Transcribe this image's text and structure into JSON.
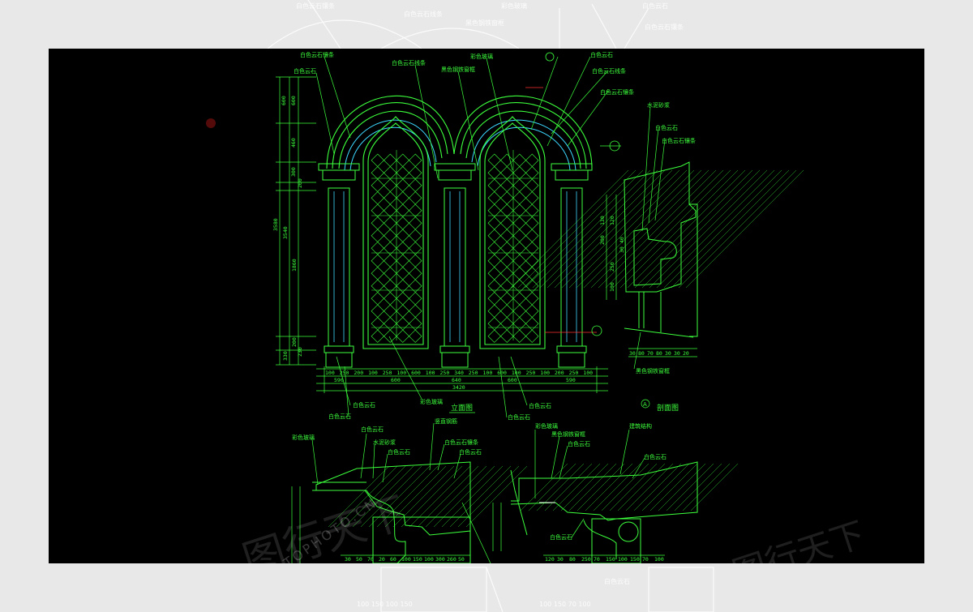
{
  "colors": {
    "line": "#3cff3c",
    "cyan": "#3cd8ff",
    "white": "#ffffff",
    "red": "#ff3030",
    "background": "#000000",
    "frame": "#e8e8e8"
  },
  "elevation": {
    "title": "立面图",
    "labels": [
      "白色云石镶条",
      "白色云石",
      "白色云石线条",
      "彩色玻璃",
      "黑色钢铁窗框",
      "白色云石",
      "白色云石线条",
      "白色云石镶条",
      "白色云石",
      "白色云石",
      "彩色玻璃",
      "白色云石",
      "白色云石"
    ],
    "vertical_dims": [
      "600",
      "600",
      "460",
      "300",
      "200",
      "3580",
      "3540",
      "1860",
      "200",
      "230",
      "330"
    ],
    "bottom_dims_row1": [
      "100",
      "250",
      "200",
      "100",
      "250",
      "100",
      "600",
      "100",
      "250",
      "340",
      "250",
      "100",
      "600",
      "100",
      "250",
      "100",
      "200",
      "250",
      "100"
    ],
    "bottom_dims_row2": [
      "590",
      "600",
      "640",
      "600",
      "590"
    ],
    "bottom_total": "3420"
  },
  "section": {
    "title": "剖面图",
    "marker": "A",
    "labels": [
      "水泥砂浆",
      "白色云石",
      "白色云石镶条",
      "黑色钢铁窗框"
    ],
    "vertical_dims": [
      "130",
      "120",
      "200",
      "250",
      "100",
      "40",
      "30"
    ],
    "bottom_dims": [
      "30",
      "80",
      "70",
      "80",
      "30",
      "30",
      "20"
    ]
  },
  "details": {
    "left_labels": [
      "彩色玻璃",
      "白色云石",
      "水泥砂浆",
      "白色云石",
      "竖直钢筋",
      "白色云石镶条",
      "白色云石"
    ],
    "right_labels": [
      "彩色玻璃",
      "黑色钢铁窗框",
      "白色云石",
      "建筑结构",
      "白色云石",
      "白色云石"
    ],
    "left_dims": [
      "30",
      "50",
      "70",
      "20",
      "60",
      "100",
      "150",
      "100",
      "300",
      "260",
      "50"
    ],
    "right_dims": [
      "120",
      "30",
      "80",
      "250",
      "70",
      "150",
      "100",
      "150",
      "70",
      "100"
    ]
  },
  "watermark": {
    "brand": "图行天下",
    "site": "PHOTOPHOTO.CN"
  }
}
